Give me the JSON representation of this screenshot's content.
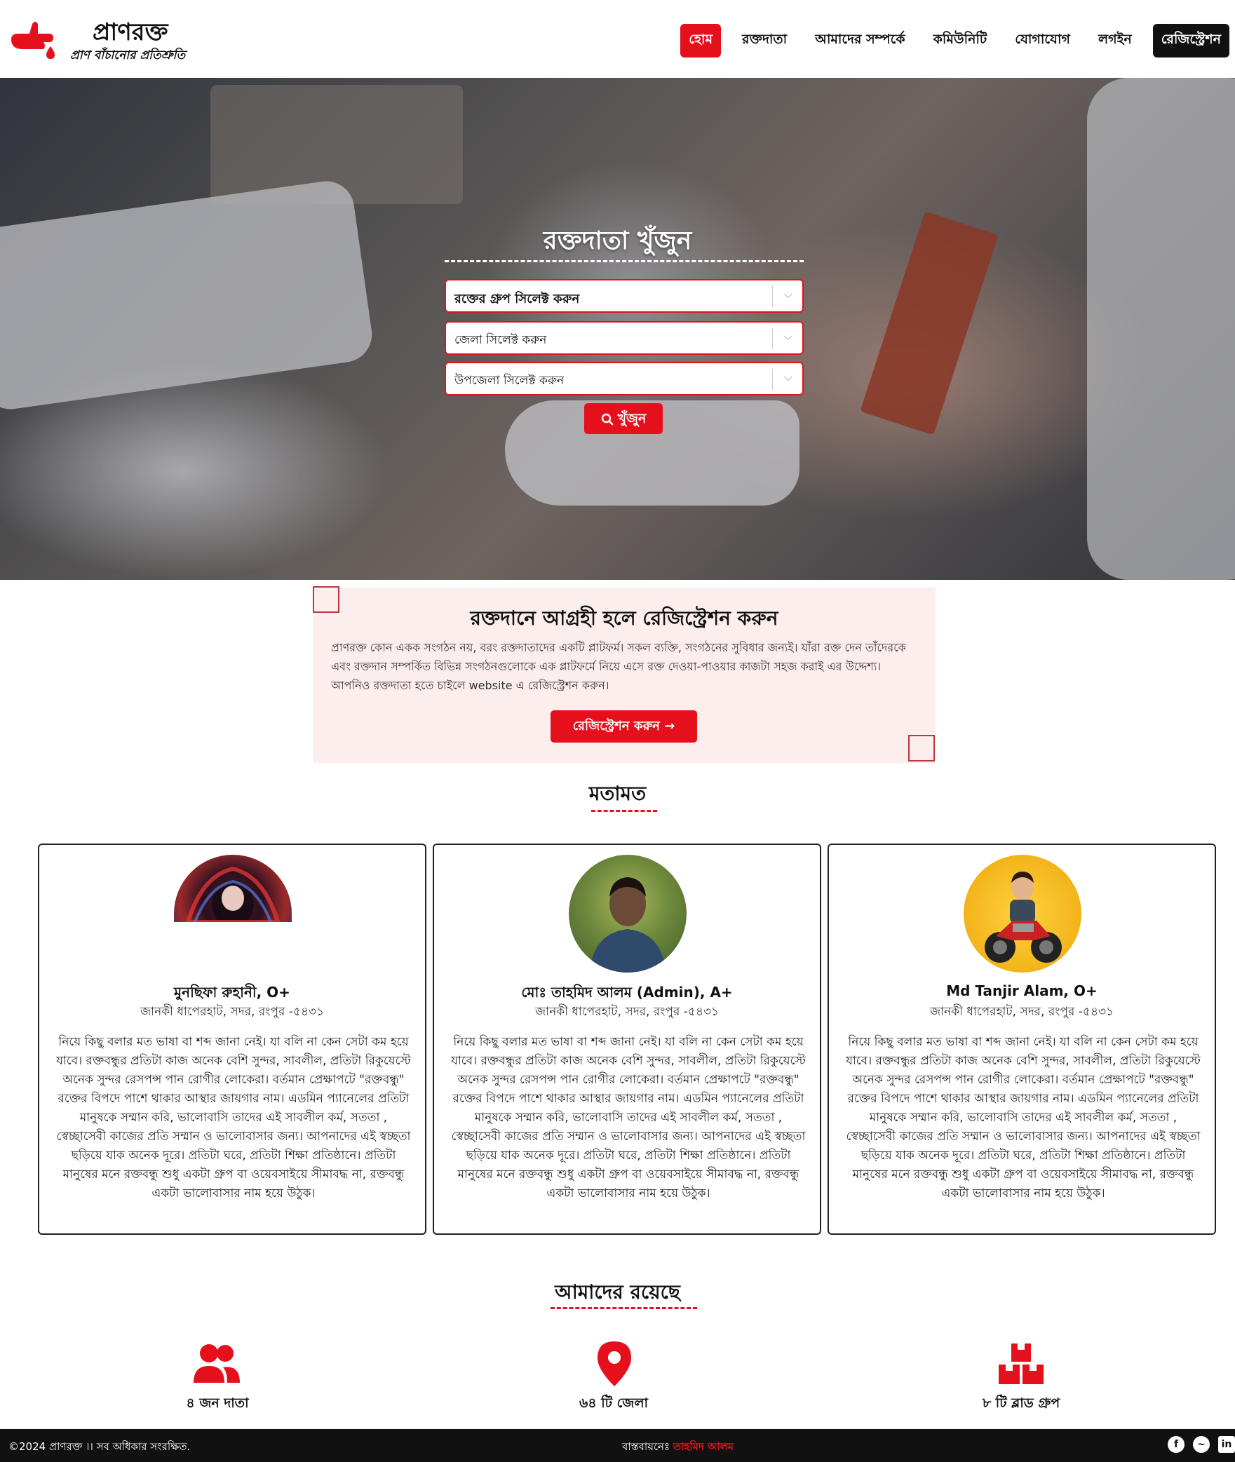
{
  "brand": {
    "title": "প্রাণরক্ত",
    "tagline": "প্রাণ বাঁচানোর প্রতিশ্রুতি",
    "accent_color": "#e6101d"
  },
  "nav": {
    "items": [
      {
        "label": "হোম",
        "active": true
      },
      {
        "label": "রক্তদাতা"
      },
      {
        "label": "আমাদের সম্পর্কে"
      },
      {
        "label": "কমিউনিটি"
      },
      {
        "label": "যোগাযোগ"
      },
      {
        "label": "লগইন"
      },
      {
        "label": "রেজিস্ট্রেশন"
      }
    ]
  },
  "search": {
    "title": "রক্তদাতা খুঁজুন",
    "blood_group_select": "রক্তের গ্রুপ সিলেক্ট করুন",
    "district_select": "জেলা সিলেক্ট করুন",
    "upazila_select": "উপজেলা সিলেক্ট করুন",
    "button": "খুঁজুন"
  },
  "registration": {
    "title": "রক্তদানে আগ্রহী হলে রেজিস্ট্রেশন করুন",
    "body": "প্রাণরক্ত কোন একক সংগঠন নয়, বরং রক্তদাতাদের একটি প্লাটফর্ম। সকল ব্যক্তি, সংগঠনের সুবিধার জন্যই। যাঁরা রক্ত দেন তাঁদেরকে এবং রক্তদান সম্পর্কিত বিভিন্ন সংগঠনগুলোকে এক প্লাটফর্মে নিয়ে এসে রক্ত দেওয়া-পাওয়ার কাজটা সহজ করাই এর উদ্দেশ্য। আপনিও রক্তদাতা হতে চাইলে website এ রেজিস্ট্রেশন করুন।",
    "button": "রেজিস্ট্রেশন করুন →"
  },
  "testimonials": {
    "heading": "মতামত",
    "items": [
      {
        "name": "মুনছিফা রুহানী, O+",
        "address": "জানকী ধাপেরহাট, সদর, রংপুর -৫৪৩১",
        "text": "নিয়ে কিছু বলার মত ভাষা বা শব্দ জানা নেই। যা বলি না কেন সেটা কম হয়ে যাবে। রক্তবন্ধুর প্রতিটা কাজ অনেক বেশি সুন্দর, সাবলীল, প্রতিটা রিকুয়েস্টে অনেক সুন্দর রেসপন্স পান রোগীর লোকেরা। বর্তমান প্রেক্ষাপটে \"রক্তবন্ধু\" রক্তের বিপদে পাশে থাকার আস্থার জায়গার নাম। এডমিন প্যানেলের প্রতিটা মানুষকে সম্মান করি, ভালোবাসি তাদের এই সাবলীল কর্ম, সততা , স্বেচ্ছাসেবী কাজের প্রতি সম্মান ও ভালোবাসার জন্য। আপনাদের এই স্বচ্ছতা ছড়িয়ে যাক অনেক দূরে। প্রতিটা ঘরে, প্রতিটা শিক্ষা প্রতিষ্ঠানে। প্রতিটা মানুষের মনে রক্তবন্ধু শুধু একটা গ্রুপ বা ওয়েবসাইয়ে সীমাবদ্ধ না, রক্তবন্ধু একটা ভালোবাসার নাম হয়ে উঠুক।"
      },
      {
        "name": "মোঃ তাহমিদ আলম (Admin), A+",
        "address": "জানকী ধাপেরহাট, সদর, রংপুর -৫৪৩১",
        "text": "নিয়ে কিছু বলার মত ভাষা বা শব্দ জানা নেই। যা বলি না কেন সেটা কম হয়ে যাবে। রক্তবন্ধুর প্রতিটা কাজ অনেক বেশি সুন্দর, সাবলীল, প্রতিটা রিকুয়েস্টে অনেক সুন্দর রেসপন্স পান রোগীর লোকেরা। বর্তমান প্রেক্ষাপটে \"রক্তবন্ধু\" রক্তের বিপদে পাশে থাকার আস্থার জায়গার নাম। এডমিন প্যানেলের প্রতিটা মানুষকে সম্মান করি, ভালোবাসি তাদের এই সাবলীল কর্ম, সততা , স্বেচ্ছাসেবী কাজের প্রতি সম্মান ও ভালোবাসার জন্য। আপনাদের এই স্বচ্ছতা ছড়িয়ে যাক অনেক দূরে। প্রতিটা ঘরে, প্রতিটা শিক্ষা প্রতিষ্ঠানে। প্রতিটা মানুষের মনে রক্তবন্ধু শুধু একটা গ্রুপ বা ওয়েবসাইয়ে সীমাবদ্ধ না, রক্তবন্ধু একটা ভালোবাসার নাম হয়ে উঠুক।"
      },
      {
        "name": "Md Tanjir Alam, O+",
        "address": "জানকী ধাপেরহাট, সদর, রংপুর -৫৪৩১",
        "text": "নিয়ে কিছু বলার মত ভাষা বা শব্দ জানা নেই। যা বলি না কেন সেটা কম হয়ে যাবে। রক্তবন্ধুর প্রতিটা কাজ অনেক বেশি সুন্দর, সাবলীল, প্রতিটা রিকুয়েস্টে অনেক সুন্দর রেসপন্স পান রোগীর লোকেরা। বর্তমান প্রেক্ষাপটে \"রক্তবন্ধু\" রক্তের বিপদে পাশে থাকার আস্থার জায়গার নাম। এডমিন প্যানেলের প্রতিটা মানুষকে সম্মান করি, ভালোবাসি তাদের এই সাবলীল কর্ম, সততা , স্বেচ্ছাসেবী কাজের প্রতি সম্মান ও ভালোবাসার জন্য। আপনাদের এই স্বচ্ছতা ছড়িয়ে যাক অনেক দূরে। প্রতিটা ঘরে, প্রতিটা শিক্ষা প্রতিষ্ঠানে। প্রতিটা মানুষের মনে রক্তবন্ধু শুধু একটা গ্রুপ বা ওয়েবসাইয়ে সীমাবদ্ধ না, রক্তবন্ধু একটা ভালোবাসার নাম হয়ে উঠুক।"
      }
    ]
  },
  "stats": {
    "heading": "আমাদের রয়েছে",
    "items": [
      {
        "icon": "users-icon",
        "label": "৪ জন দাতা"
      },
      {
        "icon": "location-pin-icon",
        "label": "৬৪ টি জেলা"
      },
      {
        "icon": "boxes-icon",
        "label": "৮ টি ব্লাড গ্রুপ"
      }
    ]
  },
  "footer": {
    "copyright": "©2024 প্রাণরক্ত ।। সব অধিকার সংরক্ষিত.",
    "credit_prefix": "বাস্তবায়নেঃ",
    "credit_name": "তাহমিদ আলম",
    "social": [
      "facebook-icon",
      "messenger-icon",
      "linkedin-icon"
    ]
  }
}
